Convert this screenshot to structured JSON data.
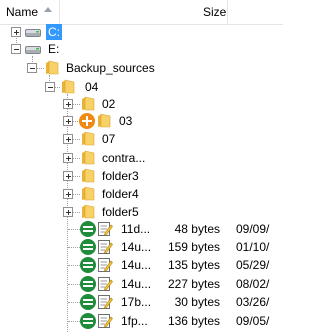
{
  "header": {
    "name_label": "Name",
    "size_label": "Size"
  },
  "colors": {
    "selection": "#3399ff",
    "badge_equal": "#1e8c3a",
    "badge_added": "#f08a17",
    "folder": "#f3c54c"
  },
  "tree": {
    "drives": [
      {
        "label": "C:",
        "icon": "hard-drive-icon",
        "selected": true,
        "expander": "plus"
      },
      {
        "label": "E:",
        "icon": "hard-drive-icon",
        "selected": false,
        "expander": "minus"
      }
    ],
    "folders": [
      {
        "label": "Backup_sources",
        "icon": "folder-icon",
        "expander": "minus"
      },
      {
        "label": "04",
        "icon": "folder-icon",
        "expander": "minus"
      },
      {
        "label": "02",
        "icon": "folder-icon",
        "expander": "plus"
      },
      {
        "label": "03",
        "icon": "folder-icon",
        "status_icon": "added-status-icon",
        "expander": "plus"
      },
      {
        "label": "07",
        "icon": "folder-icon",
        "expander": "plus"
      },
      {
        "label": "contra...",
        "icon": "folder-icon",
        "expander": "plus"
      },
      {
        "label": "folder3",
        "icon": "folder-icon",
        "expander": "plus"
      },
      {
        "label": "folder4",
        "icon": "folder-icon",
        "expander": "plus"
      },
      {
        "label": "folder5",
        "icon": "folder-icon",
        "expander": "plus"
      }
    ],
    "files": [
      {
        "name": "11d...",
        "size": "48 bytes",
        "date": "09/09/"
      },
      {
        "name": "14u...",
        "size": "159 bytes",
        "date": "01/10/"
      },
      {
        "name": "14u...",
        "size": "135 bytes",
        "date": "05/29/"
      },
      {
        "name": "14u...",
        "size": "227 bytes",
        "date": "08/02/"
      },
      {
        "name": "17b...",
        "size": "30 bytes",
        "date": "03/26/"
      },
      {
        "name": "1fp...",
        "size": "136 bytes",
        "date": "09/05/"
      }
    ],
    "file_status_icon": "equal-status-icon",
    "file_icon": "file-edit-icon"
  }
}
